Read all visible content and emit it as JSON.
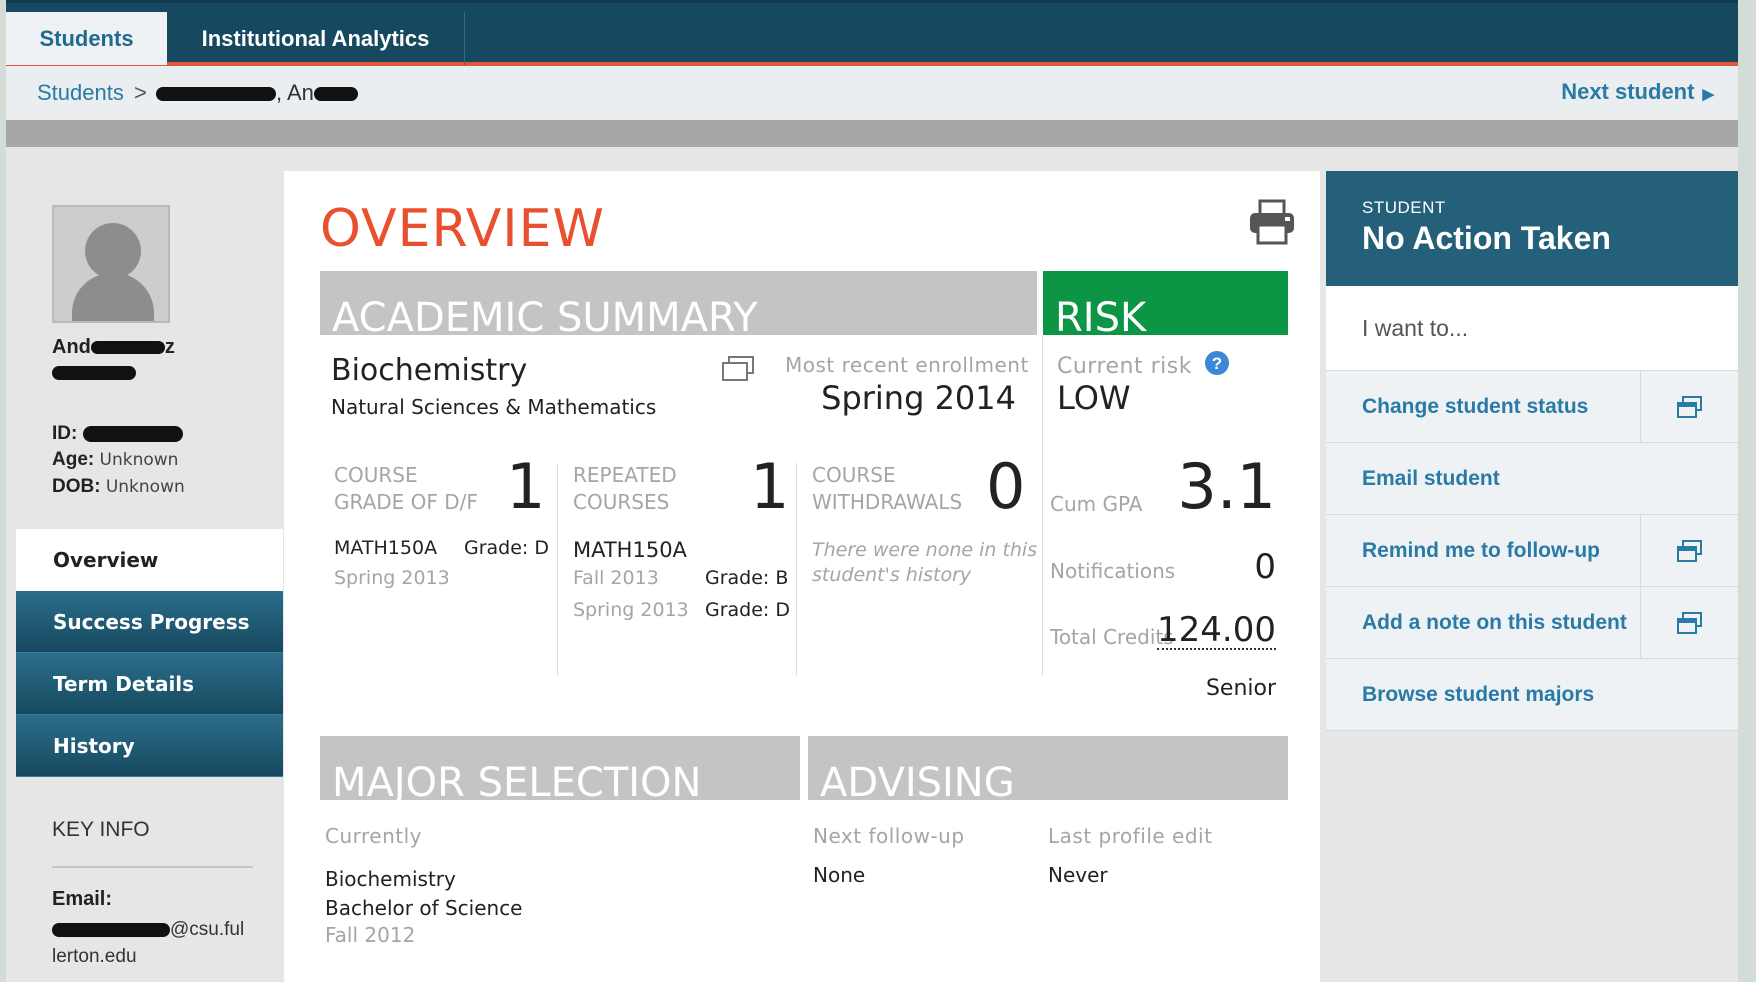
{
  "nav": {
    "tabs": [
      "Students",
      "Institutional Analytics"
    ]
  },
  "breadcrumb": {
    "root": "Students",
    "separator": ">",
    "name_visible": ", An",
    "next": "Next student"
  },
  "student": {
    "name_prefix": "And",
    "name_suffix": "z",
    "id_label": "ID:",
    "age_label": "Age:",
    "age": "Unknown",
    "dob_label": "DOB:",
    "dob": "Unknown"
  },
  "sidenav": [
    "Overview",
    "Success Progress",
    "Term Details",
    "History"
  ],
  "keyinfo": {
    "title": "KEY INFO",
    "email_label": "Email:",
    "email_domain": "@csu.ful",
    "email_domain2": "lerton.edu"
  },
  "overview": {
    "title": "OVERVIEW",
    "academic_summary": "ACADEMIC SUMMARY",
    "risk_header": "RISK",
    "major": "Biochemistry",
    "college": "Natural Sciences & Mathematics",
    "enrollment_label": "Most recent enrollment",
    "enrollment": "Spring 2014",
    "risk_label": "Current risk",
    "risk": "LOW",
    "dfcount": {
      "label1": "COURSE",
      "label2": "GRADE OF D/F",
      "value": "1",
      "course": "MATH150A",
      "grade": "Grade: D",
      "term": "Spring 2013"
    },
    "repeated": {
      "label1": "REPEATED",
      "label2": "COURSES",
      "value": "1",
      "course": "MATH150A",
      "term1": "Fall 2013",
      "grade1": "Grade: B",
      "term2": "Spring 2013",
      "grade2": "Grade: D"
    },
    "withdrawals": {
      "label1": "COURSE",
      "label2": "WITHDRAWALS",
      "value": "0",
      "note1": "There were none in this",
      "note2": "student's history"
    },
    "gpa_label": "Cum GPA",
    "gpa": "3.1",
    "notifications_label": "Notifications",
    "notifications": "0",
    "credits_label": "Total Credits",
    "credits": "124.00",
    "class_level": "Senior",
    "major_selection": "MAJOR SELECTION",
    "advising": "ADVISING",
    "currently_label": "Currently",
    "major_current": "Biochemistry",
    "degree": "Bachelor of Science",
    "major_term": "Fall 2012",
    "next_followup_label": "Next follow-up",
    "next_followup": "None",
    "last_edit_label": "Last profile edit",
    "last_edit": "Never"
  },
  "panel": {
    "status_key": "STUDENT",
    "status": "No Action Taken",
    "want": "I want to...",
    "actions": [
      "Change student status",
      "Email student",
      "Remind me to follow-up",
      "Add a note on this student",
      "Browse student majors"
    ]
  }
}
